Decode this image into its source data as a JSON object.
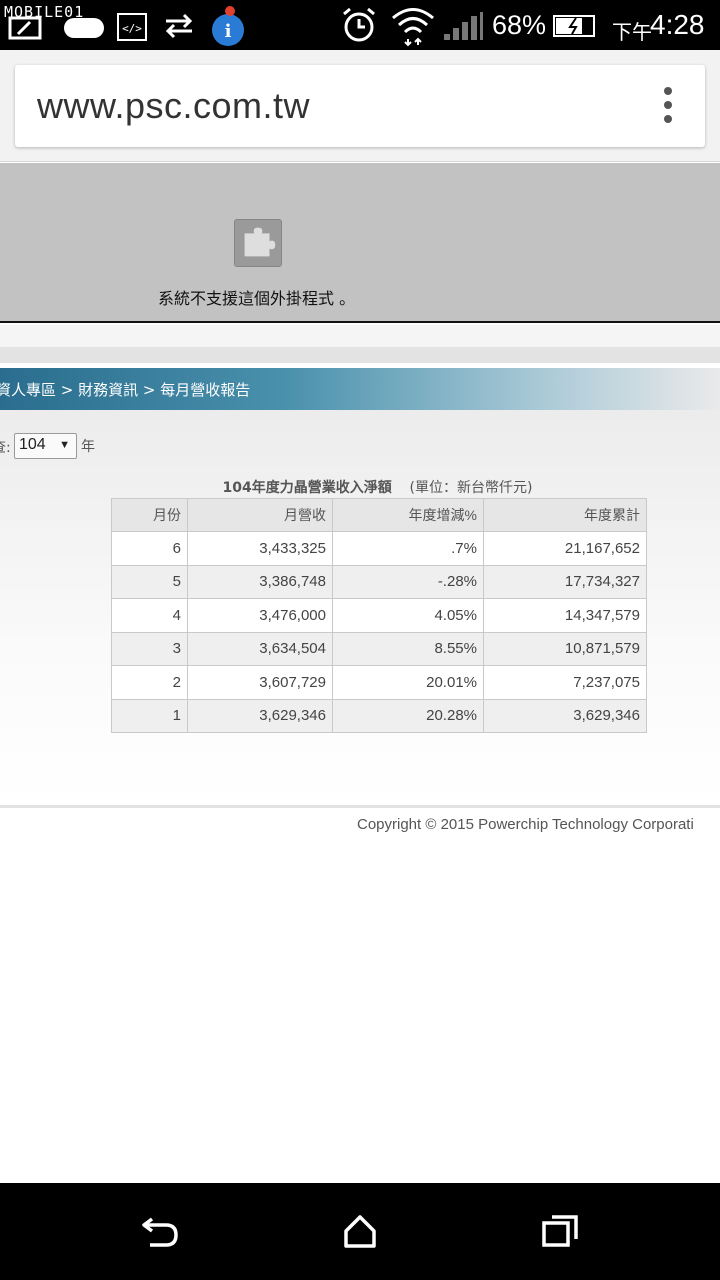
{
  "status_bar": {
    "watermark": "MOBILE01",
    "battery_percent": "68%",
    "time_prefix": "下午",
    "time": "4:28",
    "icons": [
      "screenshot-icon",
      "toggle-icon",
      "code-icon",
      "data-sync-icon",
      "info-app-icon",
      "alarm-icon",
      "wifi-icon",
      "signal-icon",
      "battery-charging-icon"
    ]
  },
  "browser": {
    "url": "www.psc.com.tw",
    "menu_icon": "overflow-menu-icon"
  },
  "plugin": {
    "icon": "puzzle-plugin-icon",
    "message": "系統不支援這個外掛程式 。"
  },
  "page": {
    "breadcrumb": "資人專區 > 財務資訊 > 每月營收報告",
    "year_label": "查:",
    "year_value": "104",
    "year_suffix": "年",
    "table_title": "104年度力晶營業收入淨額",
    "table_unit": "(單位：新台幣仟元)",
    "columns": [
      "月份",
      "月營收",
      "年度增減%",
      "年度累計"
    ],
    "rows": [
      [
        "6",
        "3,433,325",
        ".7%",
        "21,167,652"
      ],
      [
        "5",
        "3,386,748",
        "-.28%",
        "17,734,327"
      ],
      [
        "4",
        "3,476,000",
        "4.05%",
        "14,347,579"
      ],
      [
        "3",
        "3,634,504",
        "8.55%",
        "10,871,579"
      ],
      [
        "2",
        "3,607,729",
        "20.01%",
        "7,237,075"
      ],
      [
        "1",
        "3,629,346",
        "20.28%",
        "3,629,346"
      ]
    ],
    "copyright": "Copyright © 2015 Powerchip Technology Corporati"
  },
  "nav_bar": {
    "buttons": [
      "back-icon",
      "home-icon",
      "recents-icon"
    ]
  }
}
